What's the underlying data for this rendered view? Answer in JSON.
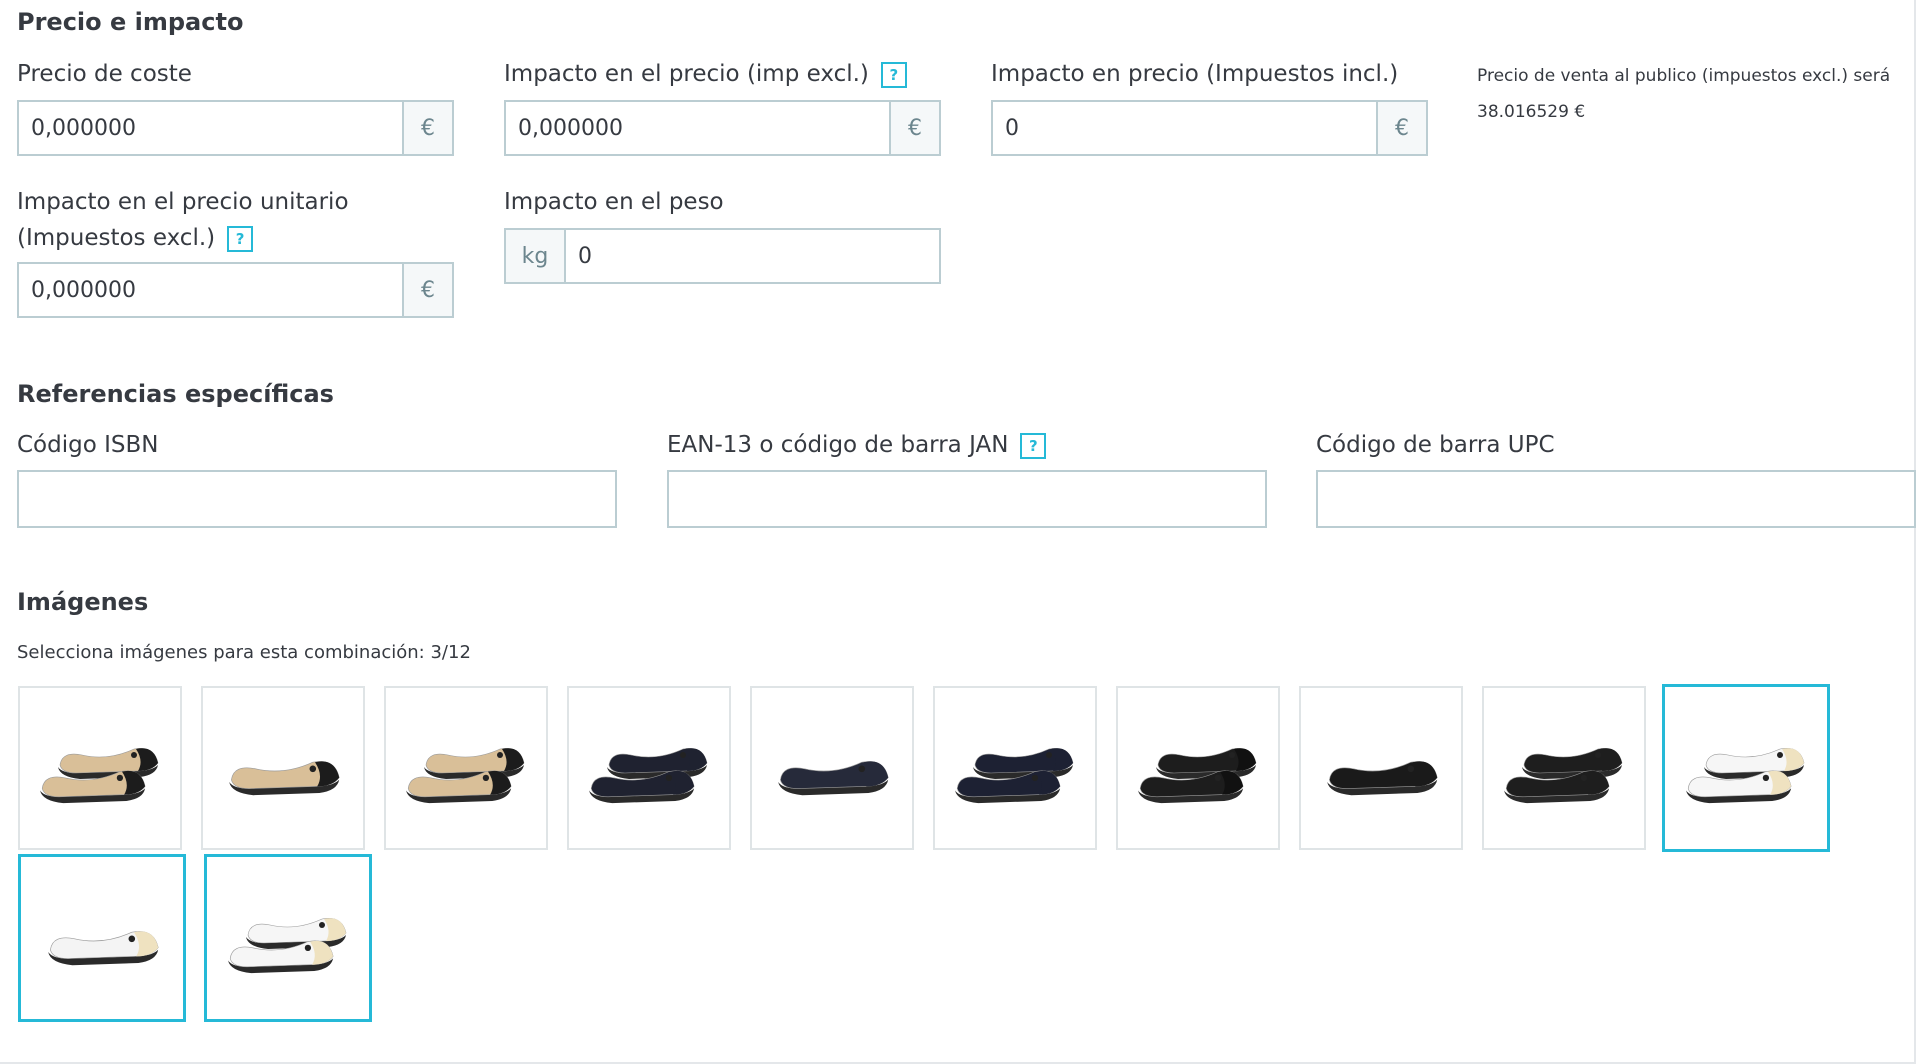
{
  "price_section": {
    "title": "Precio e impacto",
    "cost_price": {
      "label": "Precio de coste",
      "value": "0,000000",
      "addon": "€"
    },
    "price_impact_excl": {
      "label": "Impacto en el precio (imp excl.)",
      "help": "?",
      "value": "0,000000",
      "addon": "€"
    },
    "price_impact_incl": {
      "label": "Impacto en precio (Impuestos incl.)",
      "value": "0",
      "addon": "€"
    },
    "final_price_note": {
      "line1": "Precio de venta al publico (impuestos excl.) será",
      "line2": "38.016529 €"
    },
    "unit_price_impact": {
      "label_line1": "Impacto en el precio unitario",
      "label_line2": "(Impuestos excl.)",
      "help": "?",
      "value": "0,000000",
      "addon": "€"
    },
    "weight_impact": {
      "label": "Impacto en el peso",
      "addon": "kg",
      "value": "0"
    }
  },
  "references_section": {
    "title": "Referencias específicas",
    "isbn": {
      "label": "Código ISBN",
      "value": ""
    },
    "ean13": {
      "label": "EAN-13 o código de barra JAN",
      "help": "?",
      "value": ""
    },
    "upc": {
      "label": "Código de barra UPC",
      "value": ""
    }
  },
  "images_section": {
    "title": "Imágenes",
    "subtitle": "Selecciona imágenes para esta combinación: 3/12",
    "images": [
      {
        "selected": false,
        "upper": "#d9bf98",
        "toe": "#1c1c1c",
        "pair": true
      },
      {
        "selected": false,
        "upper": "#d9bf98",
        "toe": "#1c1c1c",
        "pair": false
      },
      {
        "selected": false,
        "upper": "#d9bf98",
        "toe": "#1c1c1c",
        "pair": true
      },
      {
        "selected": false,
        "upper": "#1f2230",
        "toe": "#1f2230",
        "pair": true
      },
      {
        "selected": false,
        "upper": "#262a3a",
        "toe": "#262a3a",
        "pair": false
      },
      {
        "selected": false,
        "upper": "#1d2133",
        "toe": "#1d2133",
        "pair": true
      },
      {
        "selected": false,
        "upper": "#1d1d1d",
        "toe": "#111111",
        "pair": true
      },
      {
        "selected": false,
        "upper": "#1a1a1a",
        "toe": "#1a1a1a",
        "pair": false
      },
      {
        "selected": false,
        "upper": "#1e1e1e",
        "toe": "#1e1e1e",
        "pair": true
      },
      {
        "selected": true,
        "upper": "#f6f6f6",
        "toe": "#efe2c0",
        "pair": true
      },
      {
        "selected": true,
        "upper": "#f4f4f4",
        "toe": "#efe2c0",
        "pair": false
      },
      {
        "selected": true,
        "upper": "#f6f6f6",
        "toe": "#efe2c0",
        "pair": true
      }
    ]
  },
  "colors": {
    "accent": "#25b9d7",
    "border": "#bbcdd2",
    "text": "#363a41"
  }
}
